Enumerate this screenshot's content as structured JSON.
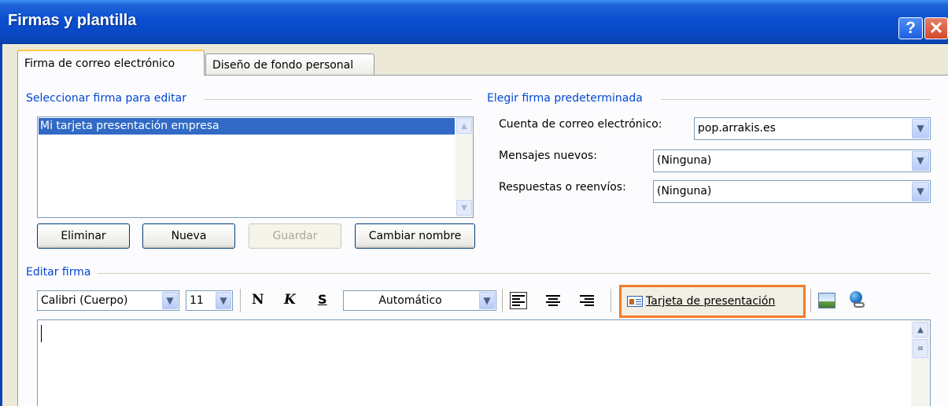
{
  "window": {
    "title": "Firmas y plantilla",
    "help_label": "?",
    "close_label": "✕"
  },
  "tabs": [
    {
      "label": "Firma de correo electrónico",
      "active": true
    },
    {
      "label": "Diseño de fondo personal",
      "active": false
    }
  ],
  "select_group": {
    "label": "Seleccionar firma para editar",
    "items": [
      "Mi tarjeta presentación empresa"
    ],
    "selected_index": 0
  },
  "buttons": {
    "delete": "Eliminar",
    "new": "Nueva",
    "save": "Guardar",
    "rename": "Cambiar nombre"
  },
  "default_group": {
    "label": "Elegir firma predeterminada",
    "account_label": "Cuenta de correo electrónico:",
    "account_value": "pop.arrakis.es",
    "new_messages_label": "Mensajes nuevos:",
    "new_messages_value": "(Ninguna)",
    "replies_label": "Respuestas o reenvíos:",
    "replies_value": "(Ninguna)"
  },
  "edit_group": {
    "label": "Editar firma"
  },
  "toolbar": {
    "font": "Calibri (Cuerpo)",
    "size": "11",
    "bold": "N",
    "italic": "K",
    "underline": "S",
    "color": "Automático",
    "business_card": "Tarjeta de presentación",
    "icons": [
      "align-left-icon",
      "align-center-icon",
      "align-right-icon",
      "business-card-icon",
      "insert-picture-icon",
      "hyperlink-icon"
    ]
  },
  "colors": {
    "title_bar": "#0a4fd0",
    "group_label": "#0046d5",
    "selection": "#316ac5",
    "highlight_border": "#f07c2a",
    "dialog_bg": "#ece9d8"
  }
}
